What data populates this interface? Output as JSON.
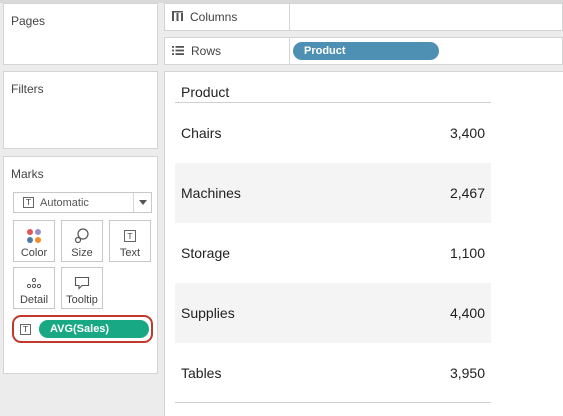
{
  "panels": {
    "pages_title": "Pages",
    "filters_title": "Filters",
    "marks_title": "Marks"
  },
  "marks": {
    "mark_type": "Automatic",
    "buttons": {
      "color": "Color",
      "size": "Size",
      "text": "Text",
      "detail": "Detail",
      "tooltip": "Tooltip"
    },
    "field_pill": "AVG(Sales)"
  },
  "shelves": {
    "columns_label": "Columns",
    "rows_label": "Rows",
    "rows_pill": "Product"
  },
  "view": {
    "header": "Product",
    "rows": [
      {
        "name": "Chairs",
        "value": "3,400"
      },
      {
        "name": "Machines",
        "value": "2,467"
      },
      {
        "name": "Storage",
        "value": "1,100"
      },
      {
        "name": "Supplies",
        "value": "4,400"
      },
      {
        "name": "Tables",
        "value": "3,950"
      }
    ]
  },
  "colors": {
    "dimension_pill": "#4e8fb4",
    "measure_pill": "#18a883",
    "highlight": "#c0392b"
  }
}
